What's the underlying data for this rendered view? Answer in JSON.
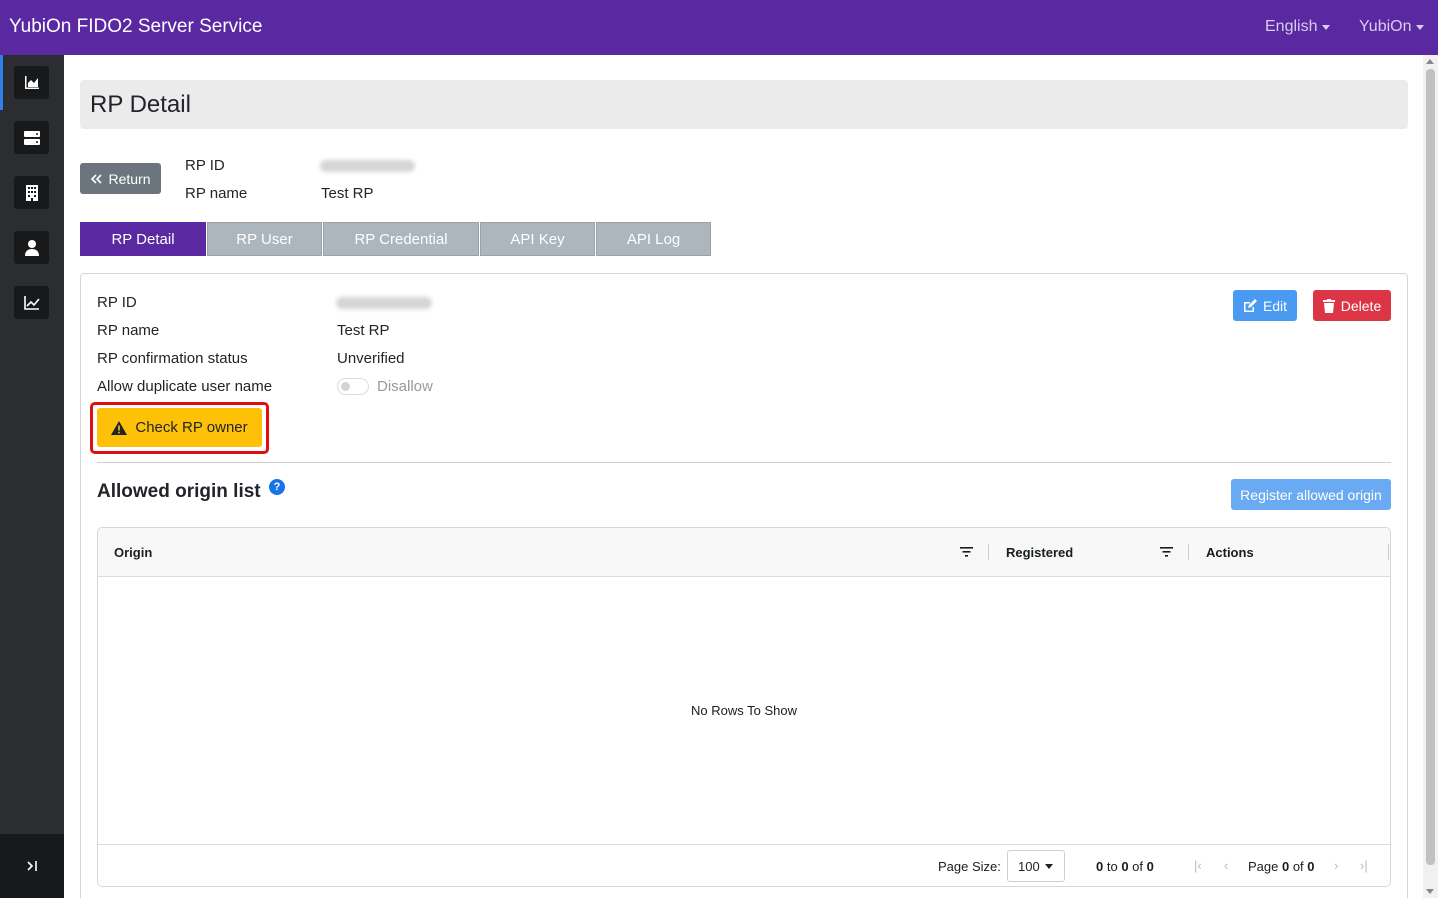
{
  "app": {
    "title": "YubiOn FIDO2 Server Service",
    "language_menu": "English",
    "user_menu": "YubiOn"
  },
  "sidebar": {
    "items": [
      {
        "icon": "area-chart-icon"
      },
      {
        "icon": "server-icon",
        "active": true
      },
      {
        "icon": "building-icon"
      },
      {
        "icon": "user-icon"
      },
      {
        "icon": "line-chart-icon"
      }
    ],
    "collapse_icon": "expand-sidebar-icon"
  },
  "page": {
    "title": "RP Detail",
    "return_label": "Return"
  },
  "summary": {
    "rp_id_label": "RP ID",
    "rp_id_value": "example.com",
    "rp_name_label": "RP name",
    "rp_name_value": "Test RP"
  },
  "tabs": [
    {
      "label": "RP Detail",
      "active": true
    },
    {
      "label": "RP User"
    },
    {
      "label": "RP Credential"
    },
    {
      "label": "API Key"
    },
    {
      "label": "API Log"
    }
  ],
  "detail": {
    "rp_id_label": "RP ID",
    "rp_id_value": "example.com",
    "rp_name_label": "RP name",
    "rp_name_value": "Test RP",
    "confirmation_label": "RP confirmation status",
    "confirmation_value": "Unverified",
    "duplicate_label": "Allow duplicate user name",
    "duplicate_value": "Disallow",
    "duplicate_enabled": false,
    "edit_label": "Edit",
    "delete_label": "Delete",
    "check_owner_label": "Check RP owner"
  },
  "origins": {
    "title": "Allowed origin list",
    "help": "?",
    "register_label": "Register allowed origin",
    "columns": [
      "Origin",
      "Registered",
      "Actions"
    ],
    "rows": [],
    "empty_message": "No Rows To Show",
    "footer": {
      "page_size_label": "Page Size:",
      "page_size_value": "100",
      "range_from": "0",
      "range_to": "0",
      "range_total": "0",
      "page_current": "0",
      "page_total": "0"
    }
  },
  "colors": {
    "brand": "#5a28a0",
    "warning": "#ffc107",
    "danger": "#dc3545",
    "primary": "#4a9af2",
    "highlight": "#e01010"
  }
}
